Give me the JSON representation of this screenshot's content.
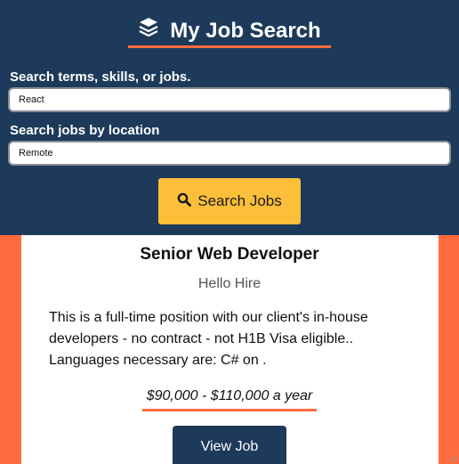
{
  "header": {
    "brand_icon": "layers-icon",
    "title": "My Job Search",
    "colors": {
      "background": "#1e3a5a",
      "accent": "#ff6b3d"
    }
  },
  "search": {
    "terms_label": "Search terms, skills, or jobs.",
    "terms_value": "React",
    "location_label": "Search jobs by location",
    "location_value": "Remote",
    "button_icon": "search-icon",
    "button_label": "Search Jobs",
    "button_color": "#fbbf3a"
  },
  "job": {
    "title": "Senior Web Developer",
    "company": "Hello Hire",
    "description": "This is a full-time position with our client's in-house developers - no contract - not H1B Visa eligible.. Languages necessary are: C# on .",
    "salary": "$90,000 - $110,000 a year",
    "view_label": "View Job"
  }
}
